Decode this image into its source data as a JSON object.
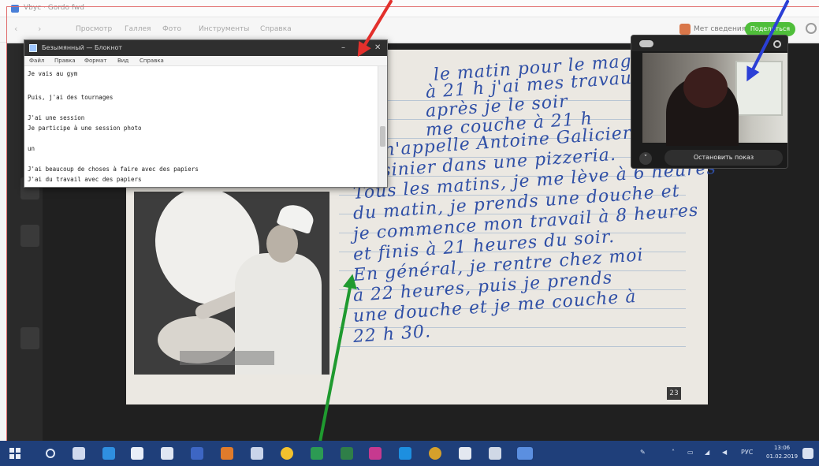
{
  "window": {
    "title": "Vbyc · Gordo fwd",
    "colors": {
      "accent_green": "#4fbe3a",
      "frame_red": "#e06b6b",
      "taskbar": "#1f3f7a"
    }
  },
  "toolbar": {
    "back_icon": "chevron-left-icon",
    "forward_icon": "chevron-right-icon",
    "menu": [
      "Просмотр",
      "Галлея",
      "Фото",
      "Инструменты",
      "Справка"
    ],
    "profile_label": "Мет сведения",
    "green_button_label": "Поделиться",
    "search_icon": "search-icon"
  },
  "notepad": {
    "title": "Безымянный — Блокнот",
    "controls": [
      "–",
      "□",
      "✕"
    ],
    "menu": [
      "Файл",
      "Правка",
      "Формат",
      "Вид",
      "Справка"
    ],
    "lines": [
      "Je vais au gym",
      "",
      "Puis, j'ai des tournages",
      "",
      "J'ai une session",
      "Je participe à une session photo",
      "",
      "un",
      "",
      "J'ai beaucoup de choses à faire avec des papiers",
      "J'ai du travail avec des papiers"
    ]
  },
  "video_call": {
    "logo": "skype-logo",
    "settings_icon": "gear-icon",
    "stop_button_label": "Остановить показ",
    "chevron_label": "˅"
  },
  "document": {
    "handwriting": [
      "le matin pour le magasin je",
      "à 21 h j'ai mes travaux",
      "après je le soir",
      "me couche à 21 h",
      "Je m'appelle Antoine Galicier, je suis",
      "cuisinier dans une pizzeria.",
      "Tous les matins, je me lève à 6 heures",
      "du matin, je prends une douche et",
      "je commence mon travail à 8 heures",
      "et finis à 21 heures du soir.",
      "En général, je rentre chez moi",
      "à 22 heures, puis je prends",
      "une douche et je me couche à",
      "22 h 30."
    ],
    "page_number": "23"
  },
  "annotations": {
    "arrow_colors": [
      "#e3302c",
      "#2b3fd6",
      "#1f9a2f"
    ]
  },
  "taskbar": {
    "start_icon": "windows-start-icon",
    "apps": [
      "search-icon",
      "task-view-icon",
      "edge-icon",
      "store-icon",
      "mail-icon",
      "word-icon",
      "firefox-icon",
      "photos-icon",
      "chrome-icon",
      "excel-icon",
      "instagram-icon",
      "skype-icon",
      "chrome-alt-icon",
      "files-icon",
      "tablet-icon",
      "photo-viewer-icon"
    ],
    "tray_language": "РУС",
    "time": "13:06",
    "date": "01.02.2019"
  }
}
